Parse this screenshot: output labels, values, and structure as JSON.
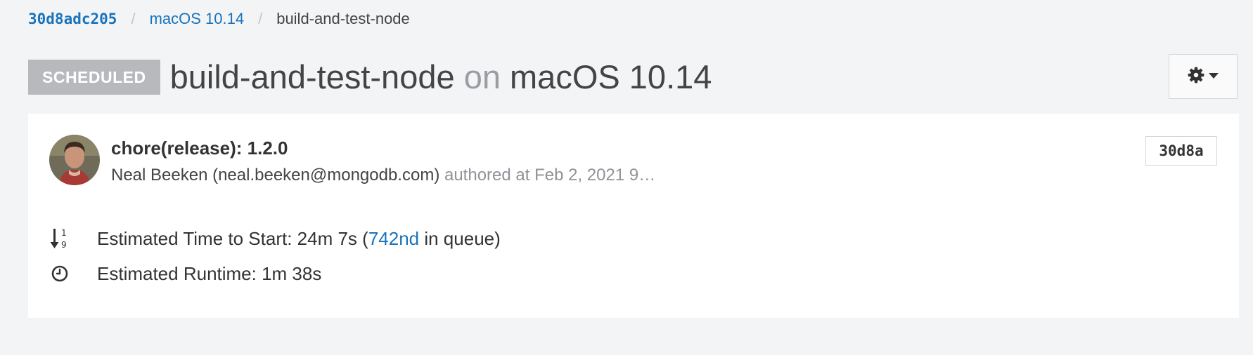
{
  "breadcrumb": {
    "commit": "30d8adc205",
    "variant": "macOS 10.14",
    "task": "build-and-test-node",
    "separator": "/"
  },
  "header": {
    "status": "SCHEDULED",
    "task_name": "build-and-test-node",
    "on_word": "on",
    "variant": "macOS 10.14",
    "settings_icon": "gear-icon",
    "dropdown_icon": "caret-down-icon"
  },
  "commit": {
    "message": "chore(release): 1.2.0",
    "author": "Neal Beeken (neal.beeken@mongodb.com)",
    "authored_text": "authored at Feb 2, 2021 9…",
    "short_sha": "30d8a"
  },
  "estimates": {
    "start_prefix": "Estimated Time to Start: 24m 7s (",
    "queue_position": "742nd",
    "start_suffix": " in queue)",
    "runtime": "Estimated Runtime: 1m 38s"
  },
  "colors": {
    "link": "#1a73bb",
    "badge": "#b7b9bc",
    "background": "#f3f4f6"
  }
}
